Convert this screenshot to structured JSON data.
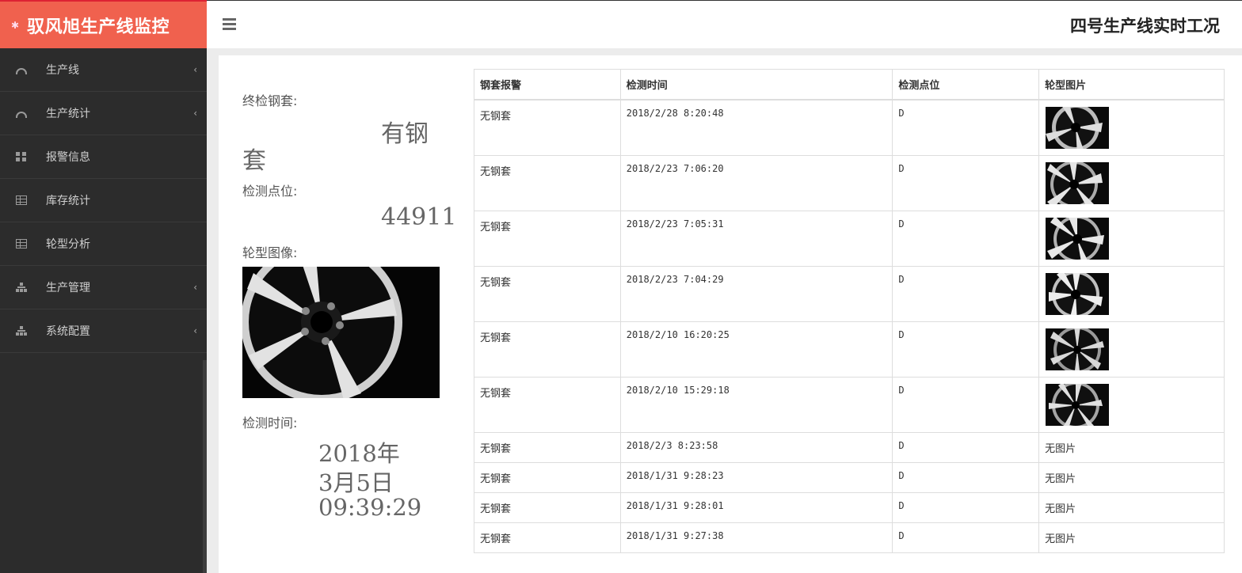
{
  "brand": {
    "title": "驭风旭生产线监控",
    "logo_icon": "gear-icon",
    "color": "#f0614e"
  },
  "header": {
    "page_title": "四号生产线实时工况"
  },
  "sidebar": {
    "items": [
      {
        "label": "生产线",
        "icon": "dashboard-icon",
        "expandable": true
      },
      {
        "label": "生产统计",
        "icon": "dashboard-icon",
        "expandable": true
      },
      {
        "label": "报警信息",
        "icon": "qrcode-icon",
        "expandable": false
      },
      {
        "label": "库存统计",
        "icon": "table-icon",
        "expandable": false
      },
      {
        "label": "轮型分析",
        "icon": "table-icon",
        "expandable": false
      },
      {
        "label": "生产管理",
        "icon": "sitemap-icon",
        "expandable": true
      },
      {
        "label": "系统配置",
        "icon": "sitemap-icon",
        "expandable": true
      }
    ]
  },
  "detail": {
    "steel_label": "终检钢套:",
    "steel_value_line1": "有钢",
    "steel_value_line2": "套",
    "point_label": "检测点位:",
    "point_value": "44911",
    "image_label": "轮型图像:",
    "time_label": "检测时间:",
    "time_line1": "2018年",
    "time_line2": "3月5日",
    "time_line3": "09:39:29"
  },
  "table": {
    "headers": [
      "钢套报警",
      "检测时间",
      "检测点位",
      "轮型图片"
    ],
    "rows": [
      {
        "alarm": "无钢套",
        "time": "2018/2/28 8:20:48",
        "point": "D",
        "image": "wheel-thumbnail"
      },
      {
        "alarm": "无钢套",
        "time": "2018/2/23 7:06:20",
        "point": "D",
        "image": "wheel-thumbnail"
      },
      {
        "alarm": "无钢套",
        "time": "2018/2/23 7:05:31",
        "point": "D",
        "image": "wheel-thumbnail"
      },
      {
        "alarm": "无钢套",
        "time": "2018/2/23 7:04:29",
        "point": "D",
        "image": "wheel-thumbnail"
      },
      {
        "alarm": "无钢套",
        "time": "2018/2/10 16:20:25",
        "point": "D",
        "image": "wheel-thumbnail"
      },
      {
        "alarm": "无钢套",
        "time": "2018/2/10 15:29:18",
        "point": "D",
        "image": "wheel-thumbnail"
      },
      {
        "alarm": "无钢套",
        "time": "2018/2/3 8:23:58",
        "point": "D",
        "image_text": "无图片"
      },
      {
        "alarm": "无钢套",
        "time": "2018/1/31 9:28:23",
        "point": "D",
        "image_text": "无图片"
      },
      {
        "alarm": "无钢套",
        "time": "2018/1/31 9:28:01",
        "point": "D",
        "image_text": "无图片"
      },
      {
        "alarm": "无钢套",
        "time": "2018/1/31 9:27:38",
        "point": "D",
        "image_text": "无图片"
      }
    ]
  }
}
